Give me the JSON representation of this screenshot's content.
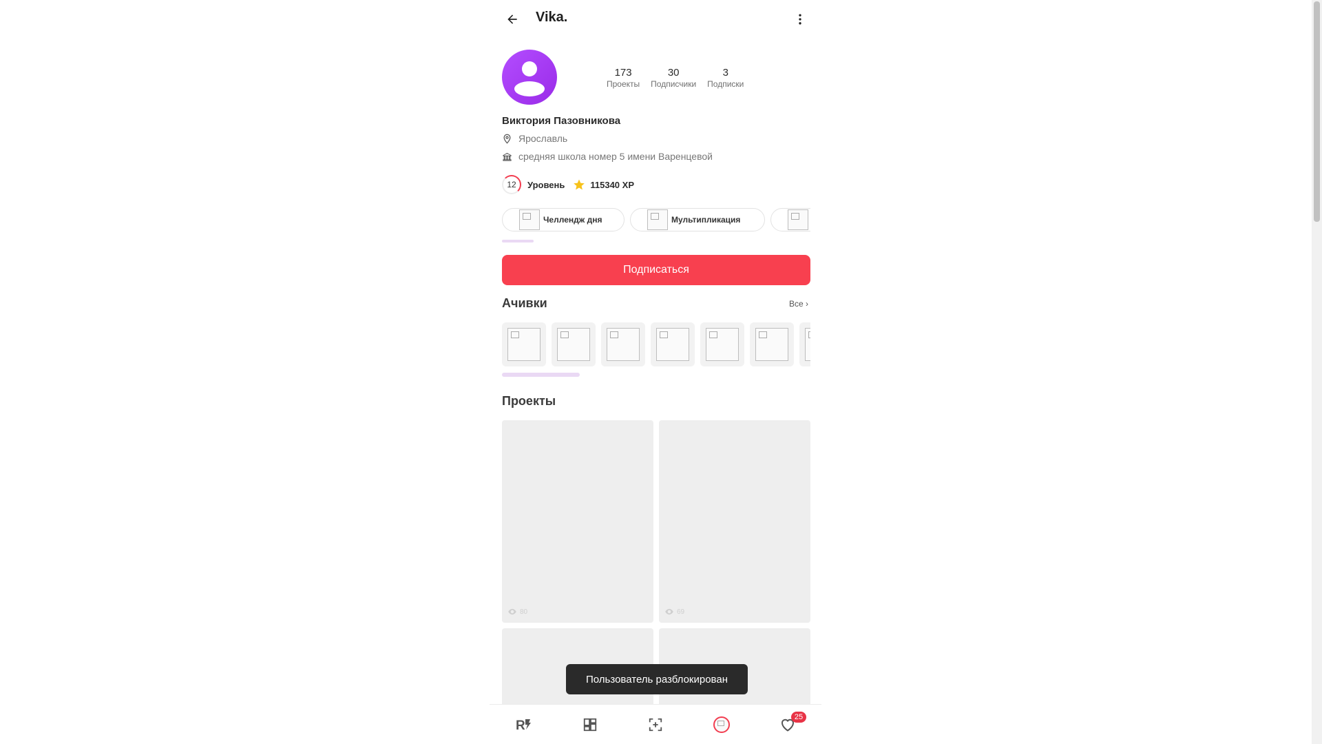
{
  "header": {
    "title": "Vika."
  },
  "profile": {
    "full_name": "Виктория Пазовникова",
    "city": "Ярославль",
    "school": "средняя школа номер 5 имени Варенцевой"
  },
  "stats": [
    {
      "value": "173",
      "label": "Проекты"
    },
    {
      "value": "30",
      "label": "Подписчики"
    },
    {
      "value": "3",
      "label": "Подписки"
    }
  ],
  "level": {
    "number": "12",
    "label": "Уровень",
    "xp": "115340 XP"
  },
  "chips": [
    {
      "label": "Челлендж дня"
    },
    {
      "label": "Мультипликация"
    },
    {
      "label": ""
    }
  ],
  "subscribe_label": "Подписаться",
  "achievements": {
    "title": "Ачивки",
    "all_label": "Все ›",
    "count_visible": 7
  },
  "projects": {
    "title": "Проекты",
    "items": [
      {
        "views": "80"
      },
      {
        "views": "69"
      },
      {
        "views": ""
      },
      {
        "views": ""
      }
    ]
  },
  "toast": "Пользователь разблокирован",
  "bottom_nav": {
    "items": [
      {
        "icon": "rocket-logo-icon"
      },
      {
        "icon": "dashboard-grid-icon"
      },
      {
        "icon": "add-frame-icon"
      },
      {
        "icon": "profile-avatar-icon"
      },
      {
        "icon": "heart-icon",
        "badge": "25"
      }
    ]
  },
  "colors": {
    "accent": "#f8404f",
    "avatar": "#a43ff0",
    "star": "#f7c21a"
  }
}
